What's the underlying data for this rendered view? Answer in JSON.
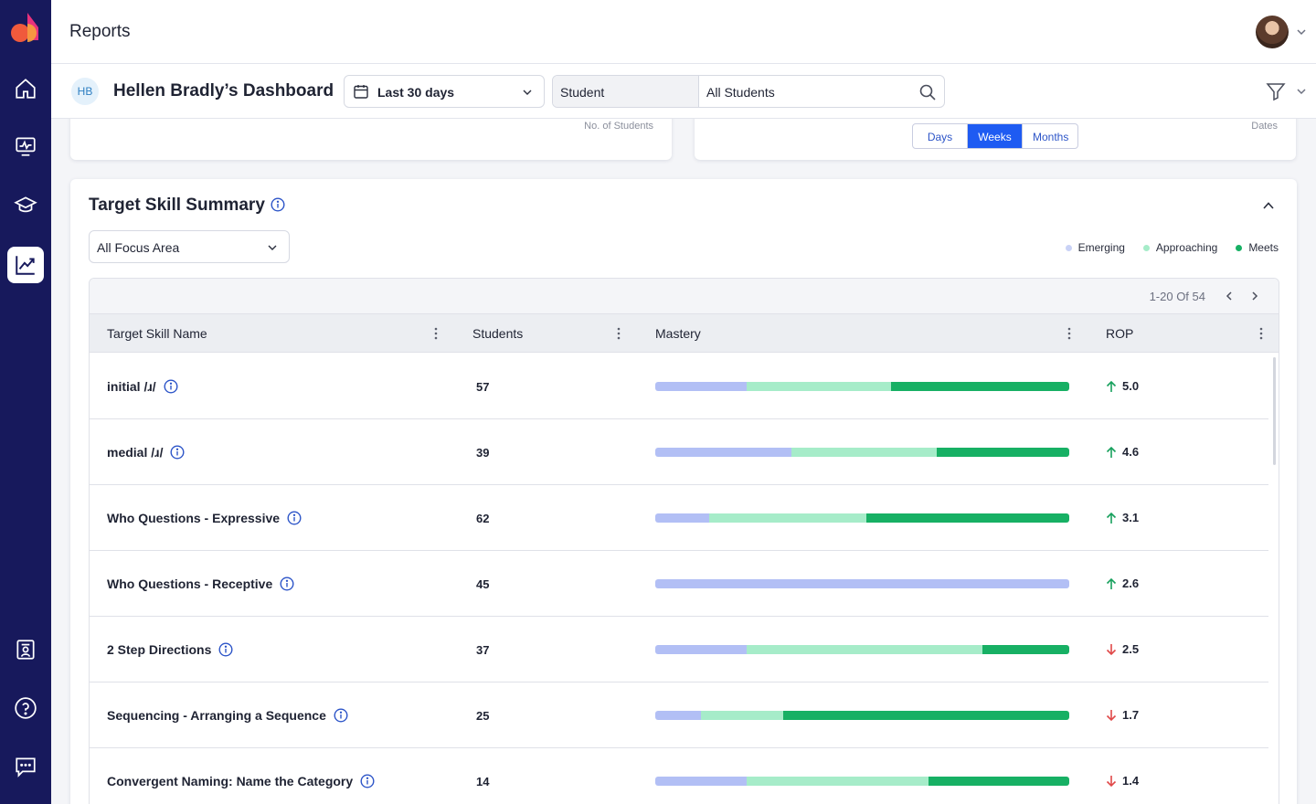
{
  "topbar": {
    "title": "Reports"
  },
  "dashboard": {
    "initials": "HB",
    "title": "Hellen Bradly’s Dashboard",
    "date_range": "Last 30 days",
    "filter_type": "Student",
    "filter_value": "All Students"
  },
  "upper_cards": {
    "left_axis_label": "No. of Students",
    "right_axis_label": "Dates",
    "granularity_options": [
      "Days",
      "Weeks",
      "Months"
    ],
    "granularity_selected": "Weeks"
  },
  "target_skill_summary": {
    "title": "Target Skill Summary",
    "focus_area": "All Focus Area",
    "legend": [
      {
        "label": "Emerging",
        "color": "#c9d2f6"
      },
      {
        "label": "Approaching",
        "color": "#a6ecc9"
      },
      {
        "label": "Meets",
        "color": "#17b064"
      }
    ],
    "pagination": "1-20 Of 54",
    "columns": [
      "Target Skill Name",
      "Students",
      "Mastery",
      "ROP"
    ],
    "rows": [
      {
        "name": "initial /ɹ/",
        "students": "57",
        "mastery": [
          22,
          35,
          43
        ],
        "rop": "5.0",
        "trend": "up"
      },
      {
        "name": "medial /ɹ/",
        "students": "39",
        "mastery": [
          33,
          35,
          32
        ],
        "rop": "4.6",
        "trend": "up"
      },
      {
        "name": "Who Questions - Expressive",
        "students": "62",
        "mastery": [
          13,
          38,
          49
        ],
        "rop": "3.1",
        "trend": "up"
      },
      {
        "name": "Who Questions - Receptive",
        "students": "45",
        "mastery": [
          100,
          0,
          0
        ],
        "rop": "2.6",
        "trend": "up"
      },
      {
        "name": "2 Step Directions",
        "students": "37",
        "mastery": [
          22,
          57,
          21
        ],
        "rop": "2.5",
        "trend": "down"
      },
      {
        "name": "Sequencing - Arranging a Sequence",
        "students": "25",
        "mastery": [
          11,
          20,
          69
        ],
        "rop": "1.7",
        "trend": "down"
      },
      {
        "name": "Convergent Naming: Name the Category",
        "students": "14",
        "mastery": [
          22,
          44,
          34
        ],
        "rop": "1.4",
        "trend": "down"
      }
    ]
  },
  "colors": {
    "sidebar": "#17195c",
    "accent": "#1e5bf2",
    "trend_up": "#17a05d",
    "trend_down": "#e04848"
  }
}
